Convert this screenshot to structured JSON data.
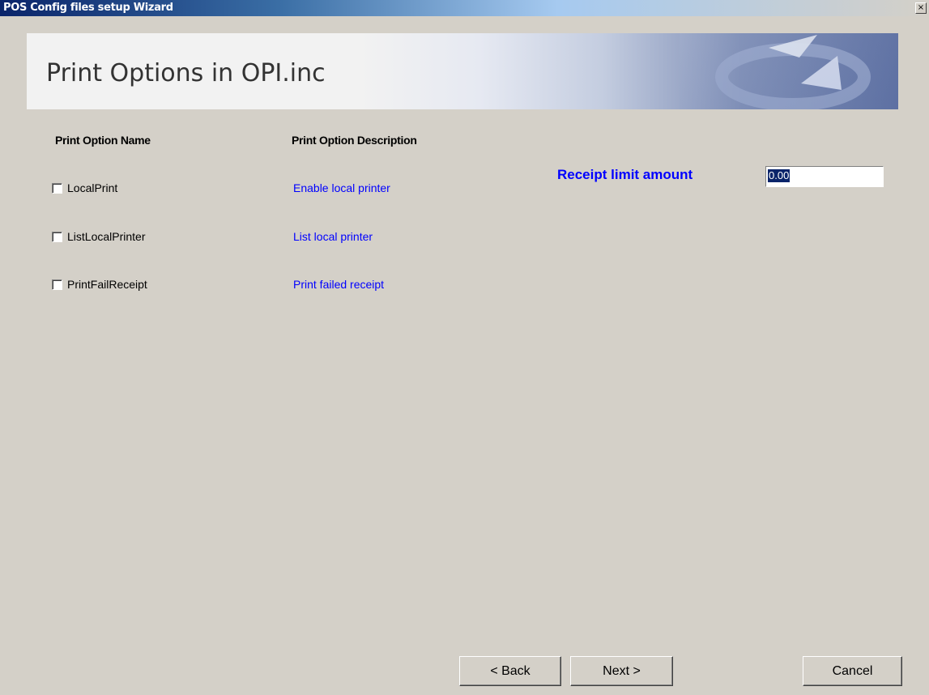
{
  "window": {
    "title": "POS Config files setup Wizard",
    "close_glyph": "×"
  },
  "banner": {
    "title": "Print Options in OPI.inc"
  },
  "headers": {
    "name": "Print Option Name",
    "description": "Print Option Description"
  },
  "options": [
    {
      "name": "LocalPrint",
      "description": "Enable local printer",
      "checked": false
    },
    {
      "name": "ListLocalPrinter",
      "description": "List local printer",
      "checked": false
    },
    {
      "name": "PrintFailReceipt",
      "description": "Print failed receipt",
      "checked": false
    }
  ],
  "receipt": {
    "label": "Receipt limit amount",
    "value": "0.00"
  },
  "buttons": {
    "back": "< Back",
    "next": "Next >",
    "cancel": "Cancel"
  },
  "colors": {
    "accent_blue": "#0000ff",
    "face": "#d4d0c8",
    "title_bar": "#0a246a"
  }
}
